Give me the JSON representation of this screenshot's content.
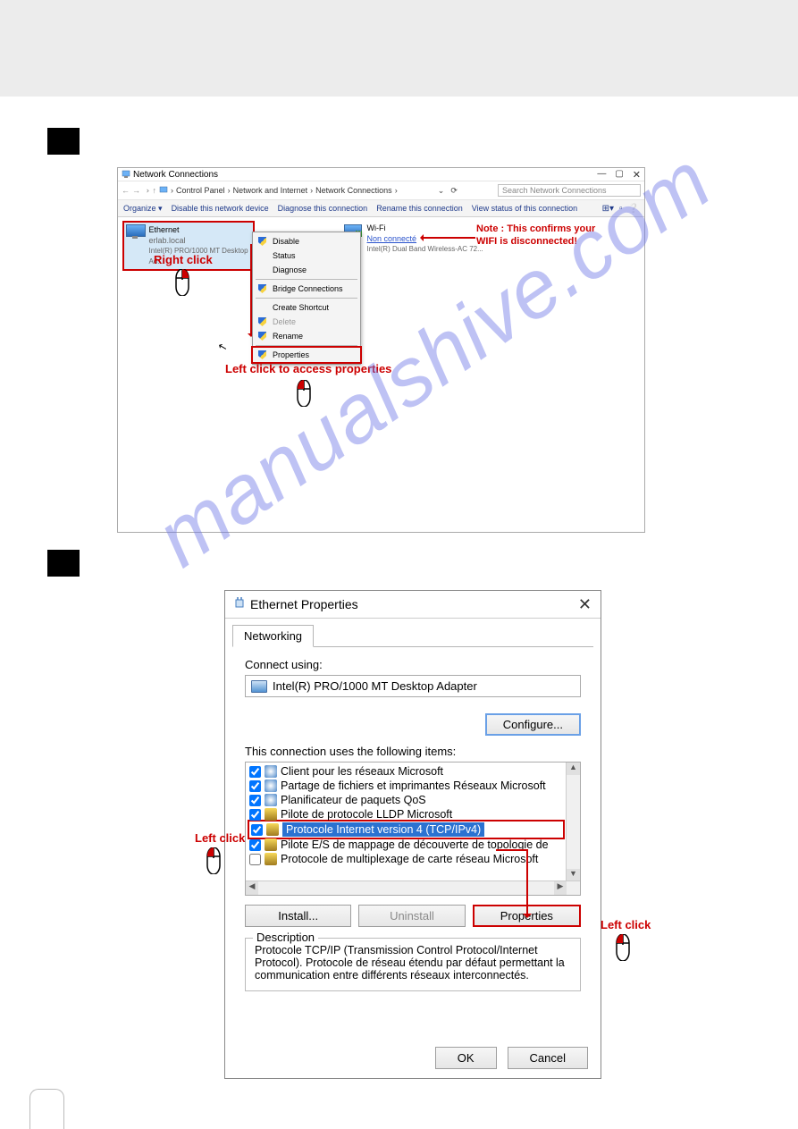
{
  "watermark": "manualshive.com",
  "nc": {
    "title": "Network Connections",
    "crumbs": [
      "Control Panel",
      "Network and Internet",
      "Network Connections"
    ],
    "search_placeholder": "Search Network Connections",
    "toolbar": {
      "organize": "Organize",
      "disable": "Disable this network device",
      "diagnose": "Diagnose this connection",
      "rename": "Rename this connection",
      "status": "View status of this connection"
    },
    "eth": {
      "name": "Ethernet",
      "domain": "erlab.local",
      "adapter": "Intel(R) PRO/1000 MT Desktop Ad..."
    },
    "wifi": {
      "name": "Wi-Fi",
      "status": "Non connecté",
      "adapter": "Intel(R) Dual Band Wireless-AC 72..."
    },
    "ctx": {
      "disable": "Disable",
      "status": "Status",
      "diagnose": "Diagnose",
      "bridge": "Bridge Connections",
      "shortcut": "Create Shortcut",
      "delete": "Delete",
      "rename": "Rename",
      "properties": "Properties"
    },
    "annot": {
      "right_click": "Right click",
      "left_click_props": "Left click to access properties",
      "wifi_note": "Note : This confirms your WIFI is disconnected!"
    }
  },
  "ep": {
    "title": "Ethernet Properties",
    "tab": "Networking",
    "connect_label": "Connect using:",
    "adapter": "Intel(R) PRO/1000 MT Desktop Adapter",
    "configure": "Configure...",
    "items_label": "This connection uses the following items:",
    "items": {
      "i0": "Client pour les réseaux Microsoft",
      "i1": "Partage de fichiers et imprimantes Réseaux Microsoft",
      "i2": "Planificateur de paquets QoS",
      "i3": "Pilote de protocole LLDP Microsoft",
      "i4": "Protocole Internet version 4 (TCP/IPv4)",
      "i5": "Pilote E/S de mappage de découverte de topologie de",
      "i6": "Protocole de multiplexage de carte réseau Microsoft"
    },
    "install": "Install...",
    "uninstall": "Uninstall",
    "properties": "Properties",
    "desc_label": "Description",
    "desc_text": "Protocole TCP/IP (Transmission Control Protocol/Internet Protocol). Protocole de réseau étendu par défaut permettant la communication entre différents réseaux interconnectés.",
    "ok": "OK",
    "cancel": "Cancel"
  },
  "side": {
    "left_click": "Left click"
  }
}
